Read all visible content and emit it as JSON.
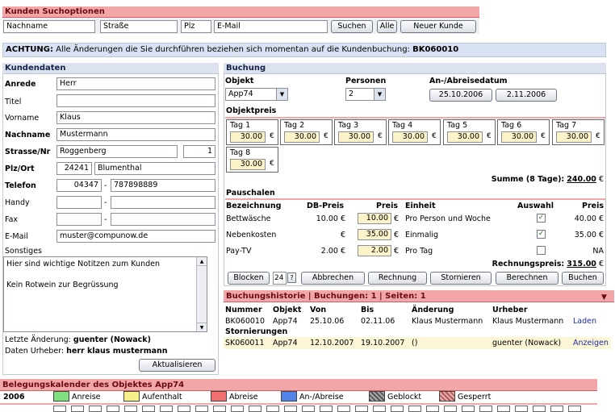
{
  "search": {
    "title": "Kunden Suchoptionen",
    "nachname": "Nachname",
    "strasse": "Straße",
    "plz": "Plz",
    "email": "E-Mail",
    "suchen": "Suchen",
    "alle": "Alle",
    "neuer_kunde": "Neuer Kunde"
  },
  "notice": {
    "label": "ACHTUNG:",
    "text": "Alle Änderungen die Sie durchführen beziehen sich momentan auf die Kundenbuchung:",
    "code": "BK060010"
  },
  "kunde": {
    "title": "Kundendaten",
    "anrede_l": "Anrede",
    "anrede": "Herr",
    "titel_l": "Titel",
    "titel": "",
    "vorname_l": "Vorname",
    "vorname": "Klaus",
    "nachname_l": "Nachname",
    "nachname": "Mustermann",
    "strasse_l": "Strasse/Nr",
    "strasse": "Roggenberg",
    "nr": "1",
    "plzort_l": "Plz/Ort",
    "plz": "24241",
    "ort": "Blumenthal",
    "telefon_l": "Telefon",
    "vorwahl": "04347",
    "nummer": "787898889",
    "dash": "-",
    "handy_l": "Handy",
    "fax_l": "Fax",
    "email_l": "E-Mail",
    "email": "muster@compunow.de",
    "sonstiges_l": "Sonstiges",
    "notes1": "Hier sind wichtige Notitzen zum Kunden",
    "notes2": "Kein Rotwein zur Begrüssung",
    "letzte_l": "Letzte Änderung:",
    "letzte": "guenter (Nowack)",
    "urheber_l": "Daten Urheber:",
    "urheber": "herr klaus mustermann",
    "aktualisieren": "Aktualisieren"
  },
  "buchung": {
    "title": "Buchung",
    "objekt_l": "Objekt",
    "objekt": "App74",
    "personen_l": "Personen",
    "personen": "2",
    "datum_l": "An-/Abreisedatum",
    "anreise": "25.10.2006",
    "abreise": "2.11.2006",
    "objektpreis_l": "Objektpreis",
    "days": [
      {
        "label": "Tag 1",
        "price": "30.00"
      },
      {
        "label": "Tag 2",
        "price": "30.00"
      },
      {
        "label": "Tag 3",
        "price": "30.00"
      },
      {
        "label": "Tag 4",
        "price": "30.00"
      },
      {
        "label": "Tag 5",
        "price": "30.00"
      },
      {
        "label": "Tag 6",
        "price": "30.00"
      },
      {
        "label": "Tag 7",
        "price": "30.00"
      },
      {
        "label": "Tag 8",
        "price": "30.00"
      }
    ],
    "euro": "€",
    "summe_l": "Summe (8 Tage):",
    "summe": "240.00",
    "pauschalen_l": "Pauschalen",
    "cols": {
      "bez": "Bezeichnung",
      "db": "DB-Preis",
      "preis": "Preis",
      "einheit": "Einheit",
      "auswahl": "Auswahl",
      "preis2": "Preis"
    },
    "rows": [
      {
        "bez": "Bettwäsche",
        "db": "10.00 €",
        "preis": "10.00",
        "einheit": "Pro Person und Woche",
        "checked": "✓",
        "total": "40.00 €"
      },
      {
        "bez": "Nebenkosten",
        "db": "€",
        "preis": "35.00",
        "einheit": "Einmalig",
        "checked": "✓",
        "total": "35.00 €"
      },
      {
        "bez": "Pay-TV",
        "db": "2.00 €",
        "preis": "2.00",
        "einheit": "Pro Tag",
        "checked": "",
        "total": "NA"
      }
    ],
    "rechnungspreis_l": "Rechnungspreis:",
    "rechnungspreis": "315.00",
    "buttons": {
      "blocken": "Blocken",
      "num": "24",
      "q": "?",
      "abbrechen": "Abbrechen",
      "rechnung": "Rechnung",
      "stornieren": "Stornieren",
      "berechnen": "Berechnen",
      "buchen": "Buchen"
    }
  },
  "historie": {
    "title": "Buchungshistorie | Buchungen: 1 | Seiten: 1",
    "cols": {
      "nummer": "Nummer",
      "objekt": "Objekt",
      "von": "Von",
      "bis": "Bis",
      "aenderung": "Änderung",
      "urheber": "Urheber"
    },
    "row": {
      "nummer": "BK060010",
      "objekt": "App74",
      "von": "25.10.06",
      "bis": "02.11.06",
      "aenderung": "Klaus Mustermann",
      "urheber": "Klaus Mustermann",
      "action": "Laden"
    },
    "storno_l": "Stornierungen",
    "storno": {
      "nummer": "SK060011",
      "objekt": "App74",
      "von": "12.10.2007",
      "bis": "19.10.2007",
      "aenderung": "()",
      "urheber": "guenter (Nowack)",
      "action": "Anzeigen"
    }
  },
  "kalender": {
    "title": "Belegungskalender des Objektes App74",
    "year": "2006",
    "legend": [
      {
        "label": "Anreise",
        "color": "#7fe07f"
      },
      {
        "label": "Aufenthalt",
        "color": "#f6f08a"
      },
      {
        "label": "Abreise",
        "color": "#f07070"
      },
      {
        "label": "An-/Abreise",
        "color": "#4f84e8"
      },
      {
        "label": "Geblockt",
        "color": "#777777"
      },
      {
        "label": "Gesperrt",
        "color": "#d98a8a"
      }
    ]
  }
}
